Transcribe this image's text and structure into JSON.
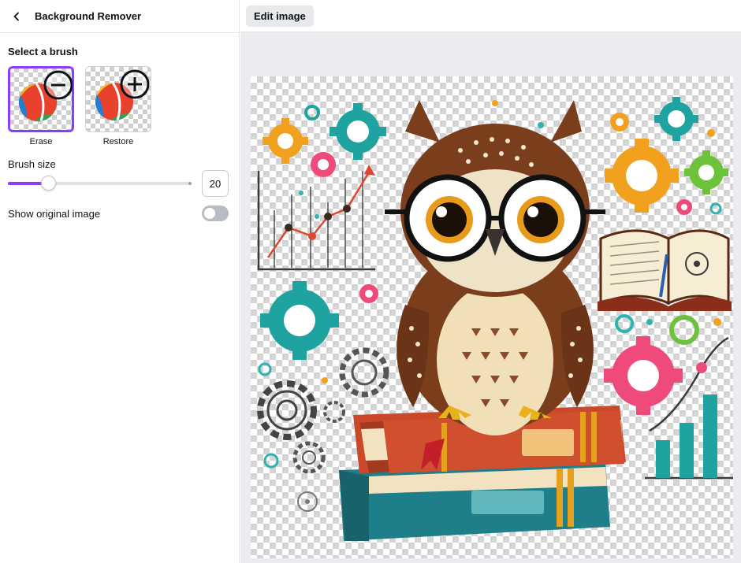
{
  "panel": {
    "title": "Background Remover",
    "select_brush_label": "Select a brush",
    "brushes": [
      {
        "label": "Erase",
        "icon": "minus-circle-icon",
        "selected": true
      },
      {
        "label": "Restore",
        "icon": "plus-circle-icon",
        "selected": false
      }
    ],
    "brush_size_label": "Brush size",
    "brush_size_value": "20",
    "show_original_label": "Show original image",
    "show_original_on": false
  },
  "workspace": {
    "edit_image_label": "Edit image"
  },
  "colors": {
    "accent": "#8b3dff",
    "toggle_off": "#b9bcc1",
    "teal": "#1fa3a0",
    "orange": "#f2a11f",
    "pink": "#ee4b7a",
    "green": "#6cc23a",
    "owl_brown": "#7a3e1d"
  }
}
